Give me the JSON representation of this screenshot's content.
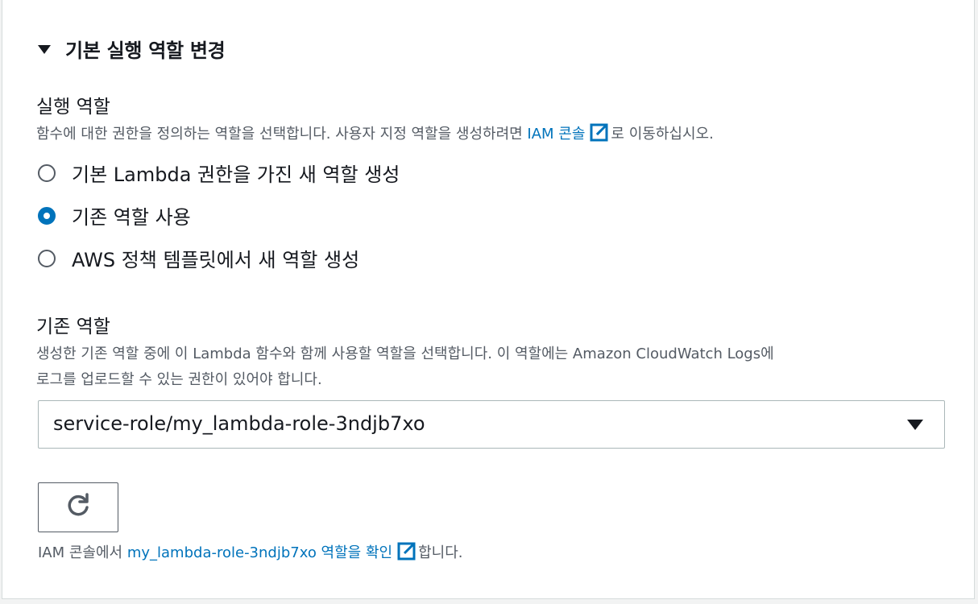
{
  "section": {
    "title": "기본 실행 역할 변경"
  },
  "execution_role": {
    "label": "실행 역할",
    "desc_prefix": "함수에 대한 권한을 정의하는 역할을 선택합니다. 사용자 지정 역할을 생성하려면 ",
    "desc_link": "IAM 콘솔",
    "desc_suffix": "로 이동하십시오.",
    "options": [
      {
        "label": "기본 Lambda 권한을 가진 새 역할 생성",
        "checked": false
      },
      {
        "label": "기존 역할 사용",
        "checked": true
      },
      {
        "label": "AWS 정책 템플릿에서 새 역할 생성",
        "checked": false
      }
    ]
  },
  "existing_role": {
    "label": "기존 역할",
    "desc_line1": "생성한 기존 역할 중에 이 Lambda 함수와 함께 사용할 역할을 선택합니다. 이 역할에는 Amazon CloudWatch Logs에",
    "desc_line2": "로그를 업로드할 수 있는 권한이 있어야 합니다.",
    "selected_value": "service-role/my_lambda-role-3ndjb7xo"
  },
  "footer": {
    "prefix": "IAM 콘솔에서 ",
    "link": "my_lambda-role-3ndjb7xo 역할을 확인",
    "suffix": "합니다."
  },
  "icons": {
    "caret": "caret-down-icon",
    "external": "external-link-icon",
    "refresh": "refresh-icon",
    "dropdown": "chevron-down-icon"
  },
  "colors": {
    "link": "#0073bb",
    "radio_selected": "#0073bb",
    "text": "#16191f",
    "muted": "#545b64"
  }
}
